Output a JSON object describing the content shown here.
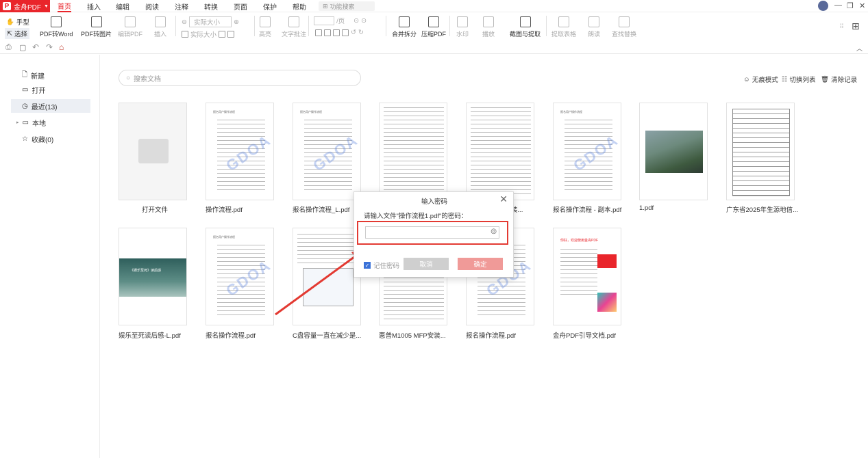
{
  "app": {
    "brand": "金舟PDF",
    "brand_glyph": "P",
    "accent": "#e9252b"
  },
  "menu": [
    "首页",
    "插入",
    "编辑",
    "阅读",
    "注释",
    "转换",
    "页面",
    "保护",
    "帮助"
  ],
  "function_search": {
    "placeholder": "功能搜索"
  },
  "toolbar": {
    "hand": "手型",
    "select": "选择",
    "pdf_to_word": "PDF转Word",
    "pdf_to_image": "PDF转图片",
    "edit_pdf": "编辑PDF",
    "insert": "插入",
    "zoom_value": "实际大小",
    "actual_size": "实际大小",
    "highlight": "高亮",
    "text_comment": "文字批注",
    "page_input": "/页",
    "merge_split": "合并拆分",
    "compress": "压缩PDF",
    "watermark": "水印",
    "play": "播放",
    "screenshot_extract": "截图与提取",
    "extract_table": "提取表格",
    "read_aloud": "朗读",
    "find_replace": "查找替换"
  },
  "sidebar": [
    {
      "label": "新建",
      "icon": "new-file-icon"
    },
    {
      "label": "打开",
      "icon": "open-file-icon"
    },
    {
      "label": "最近(13)",
      "icon": "clock-icon"
    },
    {
      "label": "本地",
      "icon": "monitor-icon"
    },
    {
      "label": "收藏(0)",
      "icon": "star-icon"
    }
  ],
  "search": {
    "placeholder": "搜索文档"
  },
  "top_actions": {
    "no_trace": "无痕模式",
    "switch_list": "切换列表",
    "clear_history": "清除记录"
  },
  "files": [
    {
      "name": "打开文件"
    },
    {
      "name": "操作流程.pdf"
    },
    {
      "name": "报名操作流程_L.pdf"
    },
    {
      "name": "...装..."
    },
    {
      "name": ""
    },
    {
      "name": "报名操作流程 - 副本.pdf"
    },
    {
      "name": "1.pdf"
    },
    {
      "name": "广东省2025年生源地信..."
    },
    {
      "name": "娱乐至死读后感-L.pdf"
    },
    {
      "name": "报名操作流程.pdf"
    },
    {
      "name": "C盘容量一直在减少是..."
    },
    {
      "name": "惠普M1005 MFP安装..."
    },
    {
      "name": "报名操作流程.pdf"
    },
    {
      "name": "金舟PDF引导文档.pdf"
    }
  ],
  "thumb_text": {
    "doc_title": "报名用户操作流程",
    "watermark": "GDOA",
    "banner": "《娱乐至死》读后感",
    "guide_title": "你好，欢迎使用金舟PDF"
  },
  "dialog": {
    "title": "输入密码",
    "prompt": "请输入文件\"操作流程1.pdf\"的密码：",
    "remember": "记住密码",
    "cancel": "取消",
    "ok": "确定"
  }
}
